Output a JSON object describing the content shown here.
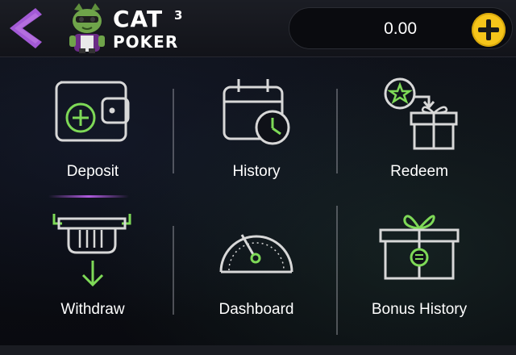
{
  "header": {
    "logo_main": "CAT",
    "logo_superscript": "3",
    "logo_sub": "POKER",
    "balance": "0.00",
    "back_icon": "chevron-left-icon",
    "add_icon": "plus-icon"
  },
  "menu": {
    "deposit": "Deposit",
    "history": "History",
    "redeem": "Redeem",
    "withdraw": "Withdraw",
    "dashboard": "Dashboard",
    "bonus_history": "Bonus History"
  },
  "colors": {
    "accent_purple": "#b05be0",
    "accent_green": "#7ed957",
    "add_button": "#f6c51a",
    "icon_stroke": "#d8d8d8"
  }
}
